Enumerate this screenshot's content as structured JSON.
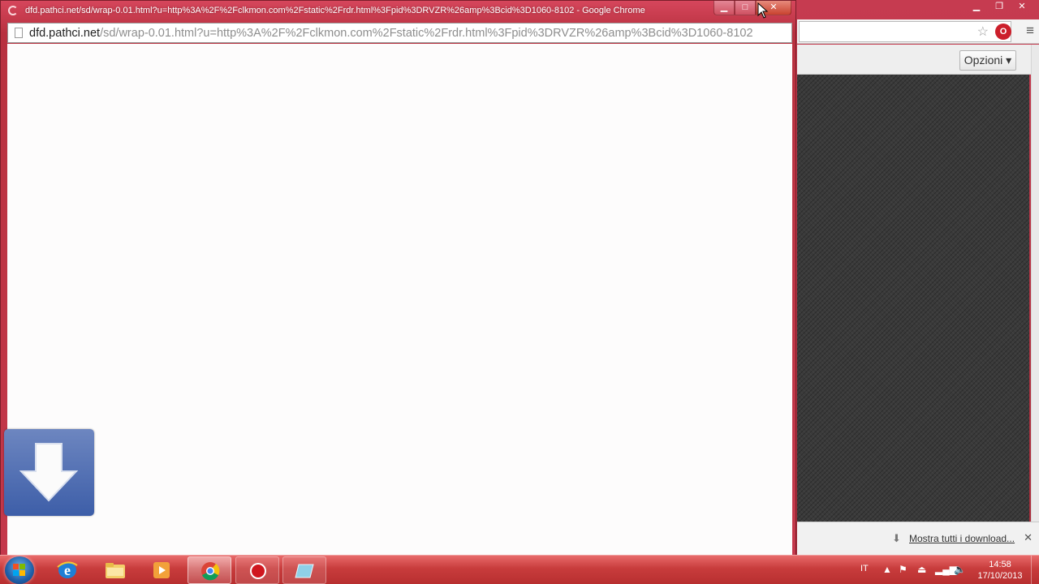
{
  "popup": {
    "title": "dfd.pathci.net/sd/wrap-0.01.html?u=http%3A%2F%2Fclkmon.com%2Fstatic%2Frdr.html%3Fpid%3DRVZR%26amp%3Bcid%3D1060-8102 - Google Chrome",
    "url_host": "dfd.pathci.net",
    "url_rest": "/sd/wrap-0.01.html?u=http%3A%2F%2Fclkmon.com%2Fstatic%2Frdr.html%3Fpid%3DRVZR%26amp%3Bcid%3D1060-8102"
  },
  "background_window": {
    "options_label": "Opzioni ▾",
    "downloads_link": "Mostra tutti i download...",
    "close_glyph": "✕"
  },
  "taskbar": {
    "language": "IT",
    "time": "14:58",
    "date": "17/10/2013"
  },
  "colors": {
    "window_frame": "#c63b50",
    "taskbar": "#c83c3c",
    "dark_pattern": "#3a3a3a"
  }
}
